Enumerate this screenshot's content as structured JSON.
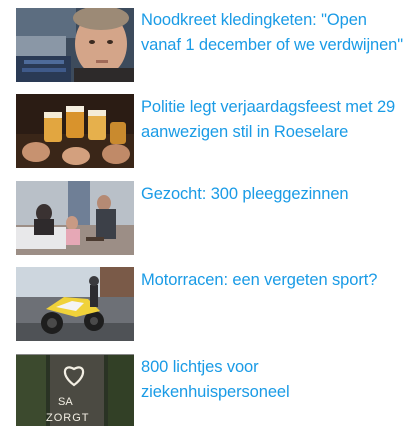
{
  "articles": [
    {
      "title": "Noodkreet kledingketen: \"Open vanaf 1 december of we verdwijnen\"",
      "image": "man-portrait-photo"
    },
    {
      "title": "Politie legt verjaardagsfeest met 29 aanwezigen stil in Roeselare",
      "image": "beer-toast-photo"
    },
    {
      "title": "Gezocht: 300 pleeggezinnen",
      "image": "family-living-room-photo"
    },
    {
      "title": "Motorracen: een vergeten sport?",
      "image": "motorbike-photo"
    },
    {
      "title": "800 lichtjes voor ziekenhuispersoneel",
      "image": "candle-heart-photo"
    }
  ],
  "image_text": {
    "candle_heart": "SA ZORGT"
  },
  "colors": {
    "link": "#1a9be6",
    "background": "#ffffff"
  }
}
